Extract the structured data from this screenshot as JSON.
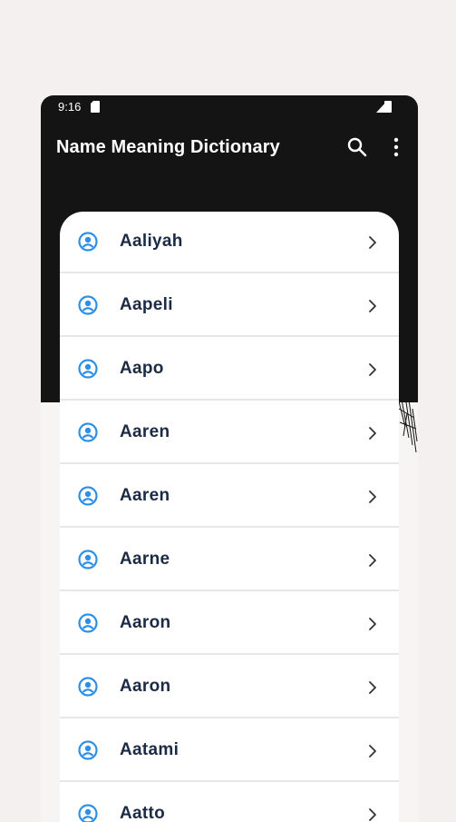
{
  "status_bar": {
    "time": "9:16"
  },
  "toolbar": {
    "title": "Name Meaning Dictionary",
    "search_icon": "search-icon",
    "more_icon": "more-vert-icon"
  },
  "colors": {
    "header": "#141414",
    "accent": "#2e8fe6",
    "name_text": "#1c2b44",
    "background": "#f3f0ef"
  },
  "names": [
    {
      "label": "Aaliyah"
    },
    {
      "label": "Aapeli"
    },
    {
      "label": "Aapo"
    },
    {
      "label": "Aaren"
    },
    {
      "label": "Aaren"
    },
    {
      "label": "Aarne"
    },
    {
      "label": "Aaron"
    },
    {
      "label": "Aaron"
    },
    {
      "label": "Aatami"
    },
    {
      "label": "Aatto"
    }
  ]
}
